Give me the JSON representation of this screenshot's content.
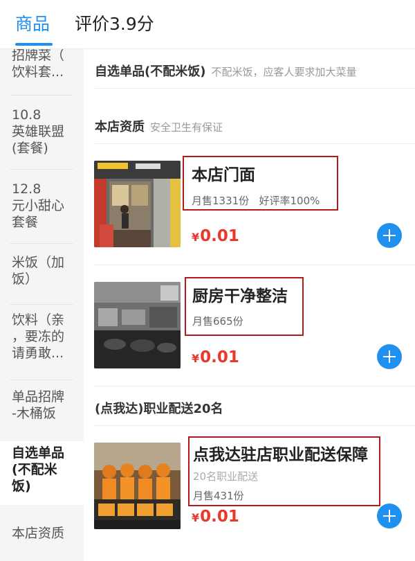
{
  "tabs": [
    {
      "label": "商品",
      "active": true
    },
    {
      "label": "评价3.9分",
      "active": false
    }
  ],
  "sidebar": {
    "items": [
      {
        "label": "招牌菜（\n饮料套..."
      },
      {
        "label": "10.8\n英雄联盟\n(套餐)"
      },
      {
        "label": "12.8\n元小甜心\n套餐"
      },
      {
        "label": "米饭（加\n饭）"
      },
      {
        "label": "饮料（亲\n，要冻的\n请勇敢..."
      },
      {
        "label": "单品招牌\n-木桶饭"
      },
      {
        "label": "自选单品\n(不配米\n饭)",
        "active": true
      },
      {
        "label": "本店资质"
      }
    ]
  },
  "sections": [
    {
      "title": "自选单品(不配米饭)",
      "subtitle": "不配米饭，应客人要求加大菜量"
    },
    {
      "title": "本店资质",
      "subtitle": "安全卫生有保证"
    },
    {
      "title": "(点我达)职业配送20名",
      "subtitle": ""
    }
  ],
  "products": [
    {
      "name": "本店门面",
      "sales": "月售1331份",
      "rating": "好评率100%",
      "price": "0.01",
      "currency": "¥",
      "image": "storefront-photo"
    },
    {
      "name": "厨房干净整洁",
      "sales": "月售665份",
      "price": "0.01",
      "currency": "¥",
      "image": "kitchen-photo"
    },
    {
      "name": "点我达驻店职业配送保障",
      "desc": "20名职业配送",
      "sales": "月售431份",
      "price": "0.01",
      "currency": "¥",
      "image": "delivery-riders-photo"
    }
  ],
  "colors": {
    "accent": "#1f8ff0",
    "price": "#e8392a",
    "highlight_box": "#b41a1a"
  }
}
